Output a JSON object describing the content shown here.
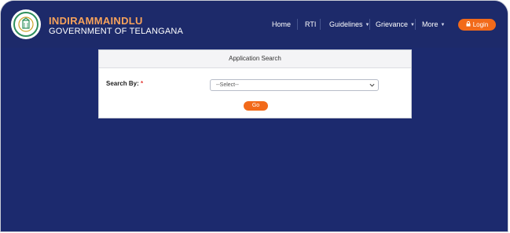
{
  "brand": {
    "title": "INDIRAMMAINDLU",
    "subtitle": "GOVERNMENT OF TELANGANA",
    "logo_icon": "telangana-emblem-icon"
  },
  "nav": {
    "items": [
      {
        "label": "Home",
        "has_dropdown": false
      },
      {
        "label": "RTI",
        "has_dropdown": false
      },
      {
        "label": "Guidelines",
        "has_dropdown": true
      },
      {
        "label": "Grievance",
        "has_dropdown": true
      },
      {
        "label": "More",
        "has_dropdown": true
      }
    ],
    "login_label": "Login",
    "login_icon": "lock-icon"
  },
  "search": {
    "title": "Application Search",
    "label": "Search By:",
    "required_mark": "*",
    "select_value": "--Select--",
    "go_label": "Go"
  },
  "colors": {
    "background": "#1c2a6e",
    "brand_title": "#f7a25b",
    "accent": "#f26a1a",
    "required": "#e53935"
  }
}
